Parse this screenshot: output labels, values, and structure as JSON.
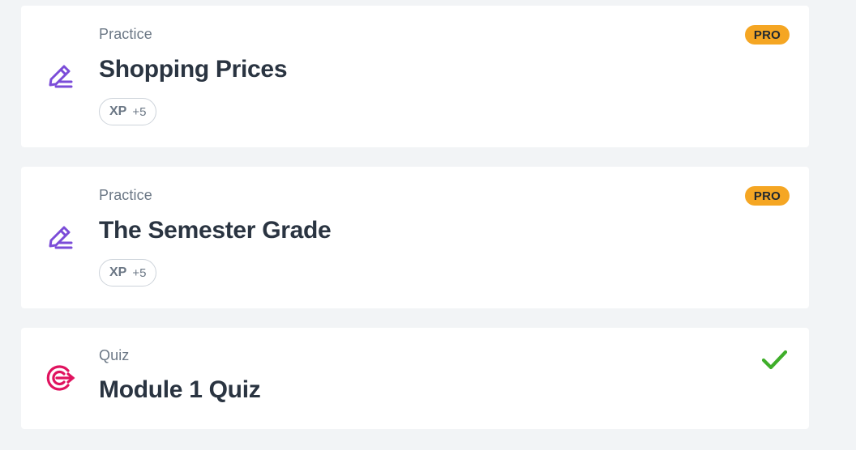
{
  "colors": {
    "practice_icon": "#7b4cd8",
    "quiz_icon": "#e0135f",
    "pro_badge": "#f5a623",
    "check": "#3fae2a"
  },
  "cards": [
    {
      "icon": "edit-pencil-icon",
      "type": "Practice",
      "title": "Shopping Prices",
      "xp_label": "XP",
      "xp_value": "+5",
      "badge": "PRO"
    },
    {
      "icon": "edit-pencil-icon",
      "type": "Practice",
      "title": "The Semester Grade",
      "xp_label": "XP",
      "xp_value": "+5",
      "badge": "PRO"
    },
    {
      "icon": "target-icon",
      "type": "Quiz",
      "title": "Module 1 Quiz",
      "status": "completed",
      "status_icon": "checkmark-icon"
    }
  ]
}
